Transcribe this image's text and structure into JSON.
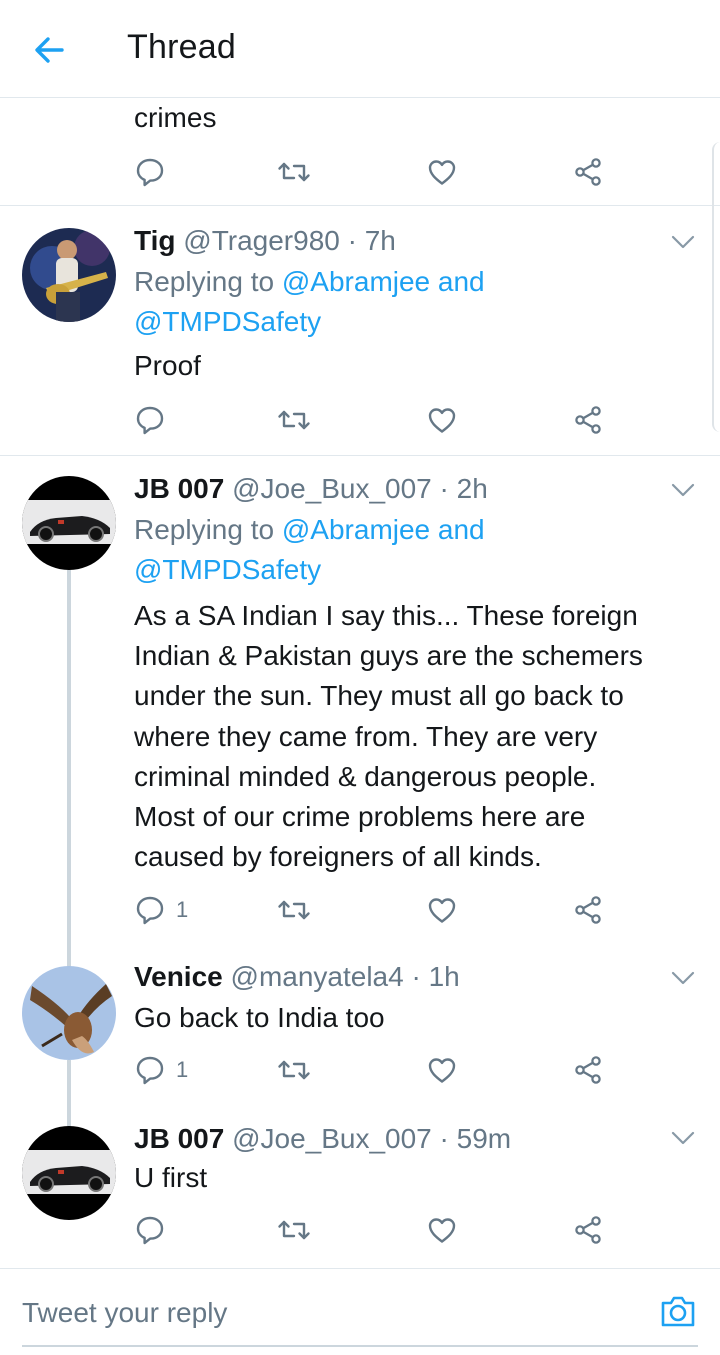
{
  "header": {
    "title": "Thread"
  },
  "previous_tweet": {
    "text_tail": "crimes"
  },
  "tweets": [
    {
      "name": "Tig",
      "handle": "@Trager980",
      "time": "7h",
      "replying_prefix": "Replying to ",
      "replying_to_1": "@Abramjee and",
      "replying_to_2": "@TMPDSafety",
      "text": "Proof",
      "reply_count": ""
    },
    {
      "name": "JB 007",
      "handle": "@Joe_Bux_007",
      "time": "2h",
      "replying_prefix": "Replying to ",
      "replying_to_1": "@Abramjee and",
      "replying_to_2": "@TMPDSafety",
      "text_lines": [
        "As a SA Indian I say this... These foreign",
        "Indian & Pakistan guys are the schemers",
        "under the sun. They must all go back to",
        "where they came from. They are very",
        "criminal minded & dangerous people.",
        "Most of our crime problems here are",
        "caused by foreigners of all kinds."
      ],
      "reply_count": "1"
    },
    {
      "name": "Venice",
      "handle": "@manyatela4",
      "time": "1h",
      "text": "Go back to India too",
      "reply_count": "1"
    },
    {
      "name": "JB 007",
      "handle": "@Joe_Bux_007",
      "time": "59m",
      "text": "U first",
      "reply_count": ""
    }
  ],
  "separator": " · ",
  "reply_bar": {
    "placeholder": "Tweet your reply"
  },
  "icons": {
    "back": "arrow-left-icon",
    "reply": "comment-icon",
    "retweet": "retweet-icon",
    "like": "heart-icon",
    "share": "share-icon",
    "more": "chevron-down-icon",
    "camera": "camera-icon"
  },
  "colors": {
    "accent": "#1da1f2",
    "secondary_text": "#657786",
    "divider": "#e1e8ed"
  }
}
